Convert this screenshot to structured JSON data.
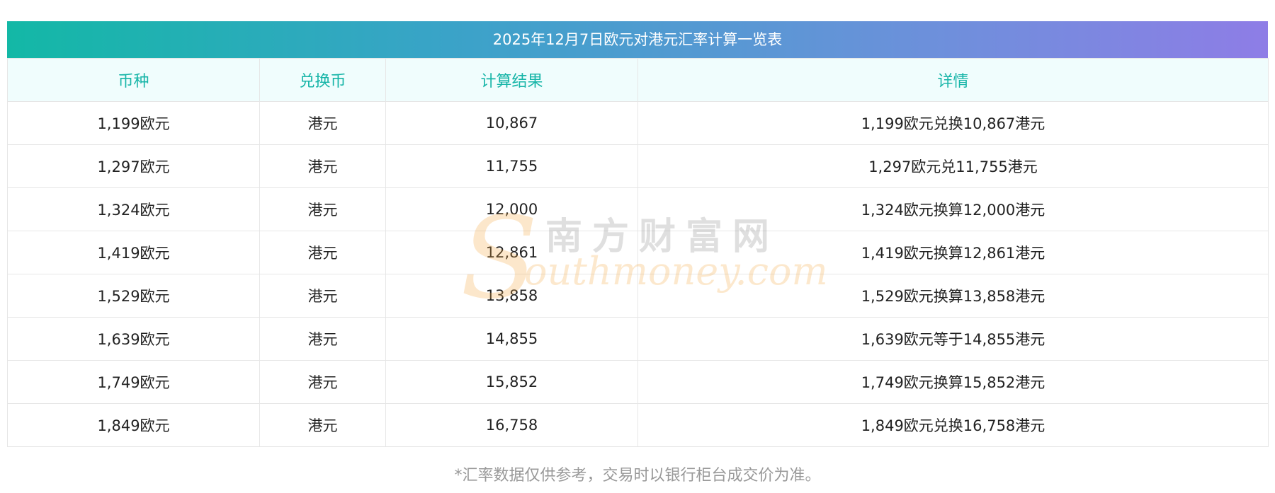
{
  "table": {
    "title": "2025年12月7日欧元对港元汇率计算一览表",
    "headers": [
      "币种",
      "兑换币",
      "计算结果",
      "详情"
    ],
    "rows": [
      {
        "currency": "1,199欧元",
        "target": "港元",
        "result": "10,867",
        "detail": "1,199欧元兑换10,867港元"
      },
      {
        "currency": "1,297欧元",
        "target": "港元",
        "result": "11,755",
        "detail": "1,297欧元兑11,755港元"
      },
      {
        "currency": "1,324欧元",
        "target": "港元",
        "result": "12,000",
        "detail": "1,324欧元换算12,000港元"
      },
      {
        "currency": "1,419欧元",
        "target": "港元",
        "result": "12,861",
        "detail": "1,419欧元换算12,861港元"
      },
      {
        "currency": "1,529欧元",
        "target": "港元",
        "result": "13,858",
        "detail": "1,529欧元换算13,858港元"
      },
      {
        "currency": "1,639欧元",
        "target": "港元",
        "result": "14,855",
        "detail": "1,639欧元等于14,855港元"
      },
      {
        "currency": "1,749欧元",
        "target": "港元",
        "result": "15,852",
        "detail": "1,749欧元换算15,852港元"
      },
      {
        "currency": "1,849欧元",
        "target": "港元",
        "result": "16,758",
        "detail": "1,849欧元兑换16,758港元"
      }
    ],
    "footnote": "*汇率数据仅供参考，交易时以银行柜台成交价为准。"
  },
  "watermark": {
    "cn": "南方财富网",
    "en": "outhmoney.com",
    "letter": "S"
  },
  "colors": {
    "header_text": "#17b5a8",
    "banner_start": "#13b8a6",
    "banner_end": "#8e7de6"
  }
}
